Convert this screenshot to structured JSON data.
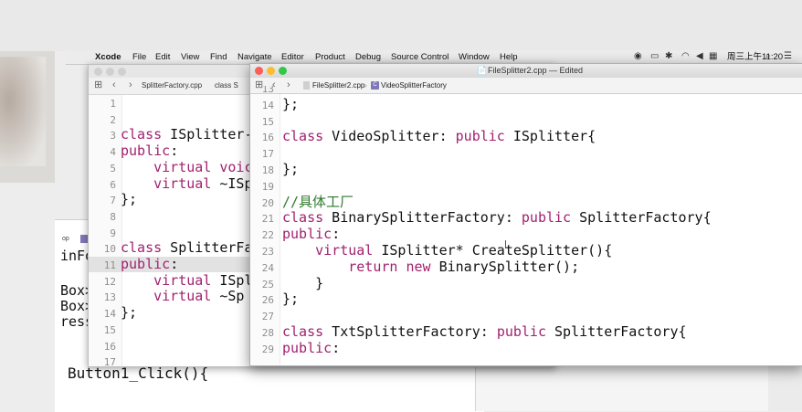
{
  "menubar": {
    "app_name": "Xcode",
    "items": [
      "File",
      "Edit",
      "View",
      "Find",
      "Navigate",
      "Editor",
      "Product",
      "Debug",
      "Source Control",
      "Window",
      "Help"
    ],
    "clock": "周三上午11:20"
  },
  "front_window": {
    "title": "FileSplitter2.cpp — Edited",
    "breadcrumb_file": "FileSplitter2.cpp",
    "breadcrumb_class": "VideoSplitterFactory",
    "lines": [
      {
        "n": "13",
        "text": ""
      },
      {
        "n": "14",
        "text": "};"
      },
      {
        "n": "15",
        "text": ""
      },
      {
        "n": "16",
        "kw": "class",
        "text": " VideoSplitter: ",
        "kw2": "public",
        "text2": " ISplitter{"
      },
      {
        "n": "17",
        "text": ""
      },
      {
        "n": "18",
        "text": "};"
      },
      {
        "n": "19",
        "text": ""
      },
      {
        "n": "20",
        "comment": "//具体工厂"
      },
      {
        "n": "21",
        "kw": "class",
        "text": " BinarySplitterFactory: ",
        "kw2": "public",
        "text2": " SplitterFactory{"
      },
      {
        "n": "22",
        "kw": "public",
        "text": ":"
      },
      {
        "n": "23",
        "indent": "    ",
        "kw": "virtual",
        "text": " ISplitter* CreateSplitter(){"
      },
      {
        "n": "24",
        "indent": "        ",
        "kw": "return",
        "text": " ",
        "kw2": "new",
        "text2": " BinarySplitter();"
      },
      {
        "n": "25",
        "indent": "    ",
        "text": "}"
      },
      {
        "n": "26",
        "text": "};"
      },
      {
        "n": "27",
        "text": ""
      },
      {
        "n": "28",
        "kw": "class",
        "text": " TxtSplitterFactory: ",
        "kw2": "public",
        "text2": " SplitterFactory{"
      },
      {
        "n": "29",
        "kw": "public",
        "text": ":"
      }
    ]
  },
  "mid_window": {
    "breadcrumb_file": "SplitterFactory.cpp",
    "breadcrumb_class": "class S",
    "lines": [
      {
        "n": "1",
        "text": ""
      },
      {
        "n": "2",
        "text": ""
      },
      {
        "n": "3",
        "kw": "class",
        "text": " ISplitter-"
      },
      {
        "n": "4",
        "kw": "public",
        "text": ":"
      },
      {
        "n": "5",
        "indent": "    ",
        "kw": "virtual",
        "text": " ",
        "kw2": "voic"
      },
      {
        "n": "6",
        "indent": "    ",
        "kw": "virtual",
        "text": " ~ISp"
      },
      {
        "n": "7",
        "text": "};"
      },
      {
        "n": "8",
        "text": ""
      },
      {
        "n": "9",
        "text": ""
      },
      {
        "n": "10",
        "kw": "class",
        "text": " SplitterFa"
      },
      {
        "n": "11",
        "kw": "public",
        "text": ":"
      },
      {
        "n": "12",
        "indent": "    ",
        "kw": "virtual",
        "text": " ISpl"
      },
      {
        "n": "13",
        "indent": "    ",
        "kw": "virtual",
        "text": " ~Sp"
      },
      {
        "n": "14",
        "text": "};"
      },
      {
        "n": "15",
        "text": ""
      },
      {
        "n": "16",
        "text": ""
      },
      {
        "n": "17",
        "text": ""
      }
    ]
  },
  "bottom_left_window": {
    "tab_text": "op",
    "lines": [
      "inFo",
      "",
      "Box>",
      "Box>",
      "ress",
      ""
    ],
    "button_text": "Button1_Click(){"
  }
}
